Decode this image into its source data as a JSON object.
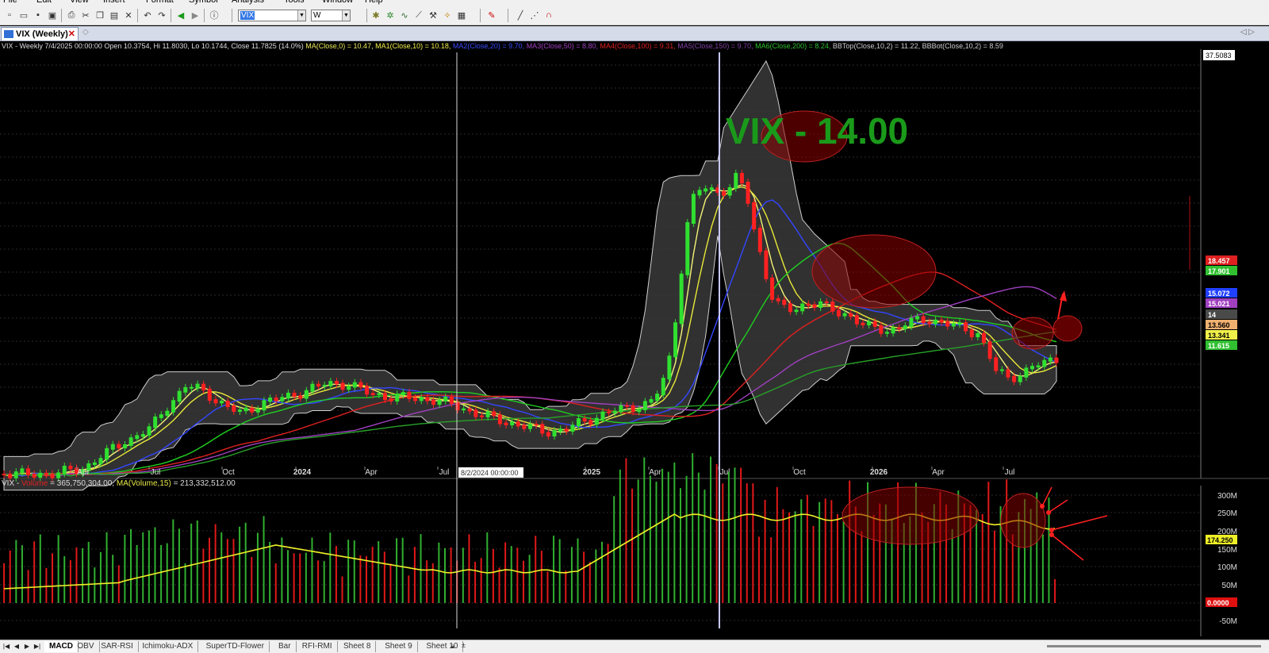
{
  "menu": [
    "File",
    "Edit",
    "View",
    "Insert",
    "Format",
    "Symbol",
    "Analysis",
    "Tools",
    "Window",
    "Help"
  ],
  "toolbar": {
    "symbol_value": "VIX",
    "interval_value": "W"
  },
  "document_tab": {
    "label": "VIX (Weekly)"
  },
  "price_panel": {
    "info_prefix": "VIX - Weekly 7/4/2025 00:00:00 Open 10.3754, Hi 11.8030, Lo 10.1744, Close 11.7825 (14.0%)",
    "indicators": [
      {
        "label": "MA(Close,0) = 10.47,",
        "color": "#e8e85a"
      },
      {
        "label": "MA1(Close,10) = 10.18,",
        "color": "#f0f04a"
      },
      {
        "label": "MA2(Close,20) = 9.70,",
        "color": "#3b4bff"
      },
      {
        "label": "MA3(Close,50) = 8.80,",
        "color": "#a040c0"
      },
      {
        "label": "MA4(Close,100) = 9.31,",
        "color": "#e02020"
      },
      {
        "label": "MA5(Close,150) = 9.70,",
        "color": "#8040a0"
      },
      {
        "label": "MA6(Close,200) = 8.24,",
        "color": "#30c030"
      },
      {
        "label": "BBTop(Close,10,2) = 11.22,",
        "color": "#cccccc"
      },
      {
        "label": "BBBot(Close,10,2) = 8.59",
        "color": "#cccccc"
      }
    ],
    "annotation": "VIX - 14.00",
    "crosshair_label": "8/2/2024 00:00:00",
    "top_value_label": "37.5083",
    "right_axis_labels": [
      "18.457",
      "17.901",
      "15.072",
      "15.021",
      "14",
      "13.560",
      "13.341",
      "11.615"
    ],
    "right_axis_colors": [
      "#e02020",
      "#30c030",
      "#2040ff",
      "#a040c0",
      "#ffffff",
      "#f0b070",
      "#f0f04a",
      "#30c030"
    ],
    "x_axis_labels": [
      "Apr",
      "Jul",
      "Oct",
      "2024",
      "Apr",
      "Jul",
      "2025",
      "Apr",
      "Jul",
      "Oct",
      "2026",
      "Apr",
      "Jul"
    ]
  },
  "volume_panel": {
    "info_prefix": "VIX - ",
    "volume_label": "Volume",
    "volume_value": "= 365,750,304.00,",
    "ma_label": "MA(Volume,15)",
    "ma_value": "= 213,332,512.00",
    "y_axis_labels": [
      "300M",
      "250M",
      "200M",
      "150M",
      "100M",
      "50M",
      "-50M"
    ],
    "current_value_label": "174.250",
    "zero_label": "0.0000"
  },
  "sheet_tabs": [
    "MACD",
    "OBV",
    "SAR-RSI",
    "Ichimoku-ADX",
    "SuperTD-Flower",
    "Bar",
    "RFI-RMI",
    "Sheet 8",
    "Sheet 9",
    "Sheet 10"
  ],
  "active_sheet": "MACD"
}
